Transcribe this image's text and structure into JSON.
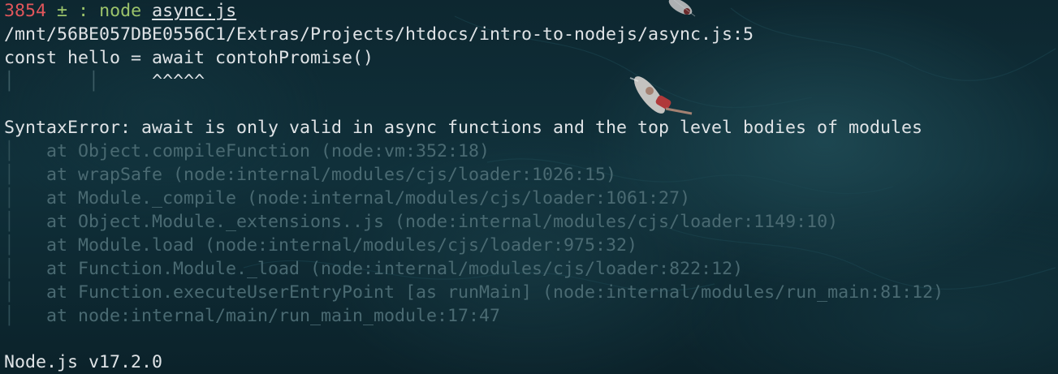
{
  "prompt": {
    "history_number": "3854",
    "symbol": "±",
    "separator": ":",
    "command": "node",
    "argument": "async.js"
  },
  "error_location": "/mnt/56BE057DBE0556C1/Extras/Projects/htdocs/intro-to-nodejs/async.js:5",
  "source_line": "const hello = await contohPromise()",
  "caret_marker": "^^^^^",
  "error_message": "SyntaxError: await is only valid in async functions and the top level bodies of modules",
  "stack_trace": [
    "at Object.compileFunction (node:vm:352:18)",
    "at wrapSafe (node:internal/modules/cjs/loader:1026:15)",
    "at Module._compile (node:internal/modules/cjs/loader:1061:27)",
    "at Object.Module._extensions..js (node:internal/modules/cjs/loader:1149:10)",
    "at Module.load (node:internal/modules/cjs/loader:975:32)",
    "at Function.Module._load (node:internal/modules/cjs/loader:822:12)",
    "at Function.executeUserEntryPoint [as runMain] (node:internal/modules/run_main:81:12)",
    "at node:internal/main/run_main_module:17:47"
  ],
  "node_version": "Node.js v17.2.0",
  "colors": {
    "history_number": "#e0565b",
    "prompt_symbols": "#9cc46b",
    "text": "#dfe3e6",
    "stack_trace": "#4a6a72",
    "background": "#10303a"
  }
}
